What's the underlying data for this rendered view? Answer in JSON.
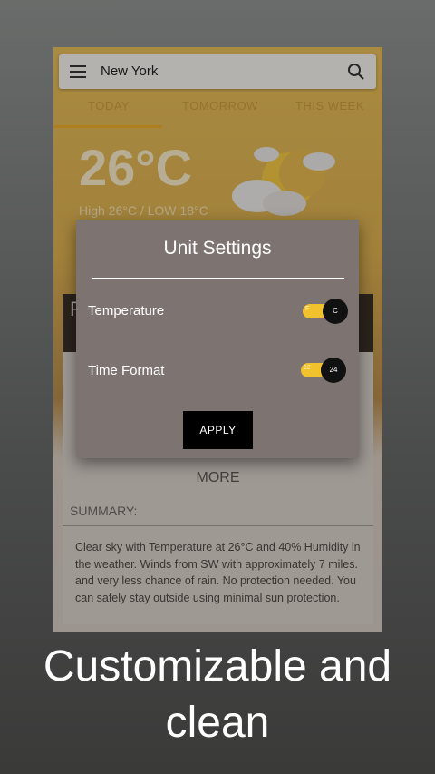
{
  "app": {
    "city": "New York",
    "tabs": [
      "TODAY",
      "TOMORROW",
      "THIS WEEK"
    ],
    "active_tab": "TODAY",
    "temperature": "26°C",
    "high_low": "High 26°C / LOW 18°C",
    "dark_band_text": "R",
    "more_label": "MORE",
    "summary_label": "SUMMARY:",
    "summary_text": "Clear sky with Temperature at 26°C and 40% Humidity in the weather. Winds from SW with approximately 7 miles. and very less chance of rain. No protection needed. You can safely stay outside using minimal sun protection."
  },
  "dialog": {
    "title": "Unit Settings",
    "rows": [
      {
        "label": "Temperature",
        "off_label": "F",
        "on_label": "C",
        "on": true
      },
      {
        "label": "Time Format",
        "off_label": "12",
        "on_label": "24",
        "on": true
      }
    ],
    "apply_label": "APPLY"
  },
  "caption": "Customizable and clean",
  "colors": {
    "accent": "#f2c12e",
    "dialog_bg": "#7d7370",
    "button_bg": "#000000"
  }
}
